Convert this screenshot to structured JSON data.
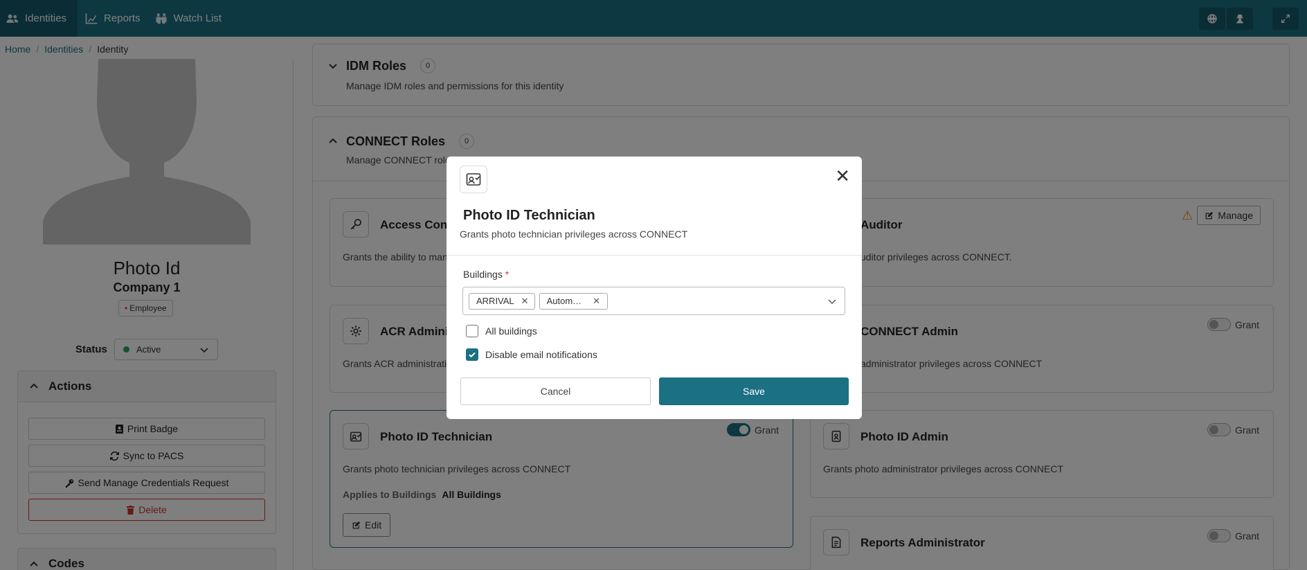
{
  "nav": {
    "items": [
      {
        "label": "Identities",
        "icon": "users-icon"
      },
      {
        "label": "Reports",
        "icon": "chart-icon"
      },
      {
        "label": "Watch List",
        "icon": "binoculars-icon"
      }
    ],
    "right_icons": [
      "globe-icon",
      "user-secret-icon",
      "expand-icon"
    ],
    "accent": "#1b7083"
  },
  "breadcrumb": {
    "home": "Home",
    "identities": "Identities",
    "current": "Identity",
    "separator": "/"
  },
  "profile": {
    "name": "Photo Id",
    "company": "Company 1",
    "type": "Employee",
    "status_label": "Status",
    "status_value": "Active"
  },
  "actions": {
    "title": "Actions",
    "print_badge": "Print Badge",
    "sync": "Sync to PACS",
    "send_request": "Send Manage Credentials Request",
    "delete": "Delete"
  },
  "codes": {
    "title": "Codes"
  },
  "idm_roles": {
    "title": "IDM Roles",
    "count": "0",
    "description": "Manage IDM roles and permissions for this identity"
  },
  "connect_roles": {
    "title": "CONNECT Roles",
    "count": "0",
    "description": "Manage CONNECT roles"
  },
  "roles": {
    "access_control": {
      "title": "Access Cont",
      "desc": "Grants the ability to man"
    },
    "auditor": {
      "title": "Auditor",
      "desc": "uditor privileges across CONNECT.",
      "manage": "Manage"
    },
    "acr_admin": {
      "title": "ACR Adminis",
      "desc": "Grants ACR administrati"
    },
    "connect_admin": {
      "title": "CONNECT Admin",
      "desc": "administrator privileges across CONNECT",
      "grant": "Grant",
      "granted": false
    },
    "photo_tech": {
      "title": "Photo ID Technician",
      "desc": "Grants photo technician privileges across CONNECT",
      "grant": "Grant",
      "granted": true,
      "applies_label": "Applies to Buildings",
      "applies_value": "All Buildings",
      "edit": "Edit"
    },
    "photo_admin": {
      "title": "Photo ID Admin",
      "desc": "Grants photo administrator privileges across CONNECT",
      "grant": "Grant",
      "granted": false
    },
    "reports_admin": {
      "title": "Reports Administrator",
      "grant": "Grant",
      "granted": false
    }
  },
  "modal": {
    "title": "Photo ID Technician",
    "subtitle": "Grants photo technician privileges across CONNECT",
    "buildings_label": "Buildings",
    "required_mark": "*",
    "chips": [
      "ARRIVAL",
      "Autom…"
    ],
    "all_buildings": "All buildings",
    "all_buildings_checked": false,
    "disable_email": "Disable email notifications",
    "disable_email_checked": true,
    "cancel": "Cancel",
    "save": "Save"
  }
}
